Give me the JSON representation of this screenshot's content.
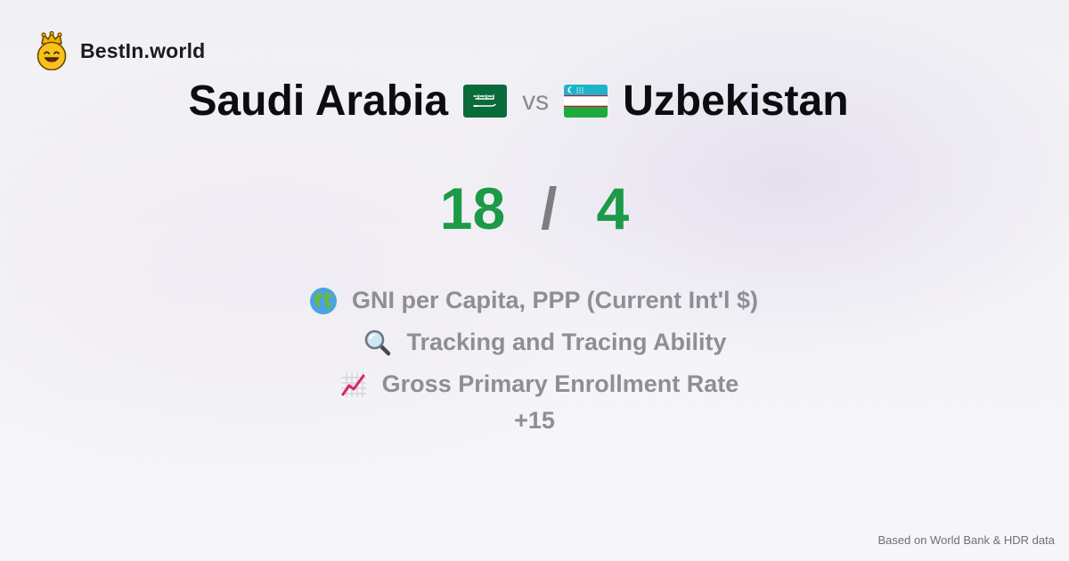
{
  "brand": {
    "name": "BestIn.world",
    "logo_icon": "crowned-smiley-icon"
  },
  "comparison": {
    "country_a": "Saudi Arabia",
    "flag_a": "saudi-arabia-flag-icon",
    "vs_label": "vs",
    "country_b": "Uzbekistan",
    "flag_b": "uzbekistan-flag-icon"
  },
  "score": {
    "a": "18",
    "separator": "/",
    "b": "4",
    "color": "#1b9a47"
  },
  "metrics": [
    {
      "icon": "globe-icon",
      "label": "GNI per Capita, PPP (Current Int'l $)"
    },
    {
      "icon": "magnifying-glass-icon",
      "label": "Tracking and Tracing Ability"
    },
    {
      "icon": "chart-increasing-icon",
      "label": "Gross Primary Enrollment Rate"
    }
  ],
  "more_count": "+15",
  "footer": {
    "source_note": "Based on World Bank & HDR data"
  }
}
